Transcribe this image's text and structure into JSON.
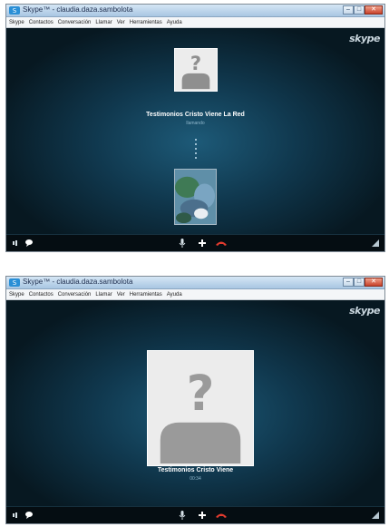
{
  "window1": {
    "title": "Skype™ - claudia.daza.sambolota",
    "menu": [
      "Skype",
      "Contactos",
      "Conversación",
      "Llamar",
      "Ver",
      "Herramientas",
      "Ayuda"
    ],
    "logo": "skype",
    "contact_name": "Testimonios Cristo Viene La Red",
    "call_status": "llamando",
    "icons": [
      "volume-icon",
      "chat-bubble-icon",
      "microphone-icon",
      "plus-icon",
      "hang-up-icon",
      "signal-icon"
    ]
  },
  "window2": {
    "title": "Skype™ - claudia.daza.sambolota",
    "menu": [
      "Skype",
      "Contactos",
      "Conversación",
      "Llamar",
      "Ver",
      "Herramientas",
      "Ayuda"
    ],
    "logo": "skype",
    "contact_name": "Testimonios Cristo Viene",
    "call_status": "00:34",
    "icons": [
      "volume-icon",
      "chat-bubble-icon",
      "microphone-icon",
      "plus-icon",
      "hang-up-icon",
      "signal-icon"
    ]
  },
  "colors": {
    "stage": "#10384e",
    "hangup": "#e23b2e",
    "titlebar": "#a8c6e2"
  }
}
